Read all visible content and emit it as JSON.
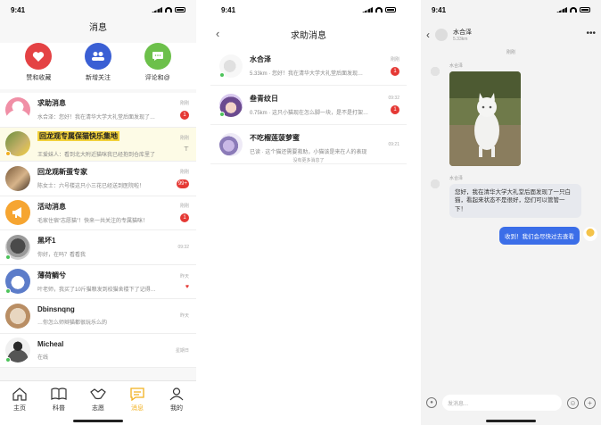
{
  "screen1": {
    "status_time": "9:41",
    "title": "消息",
    "quick_actions": [
      {
        "label": "赞和收藏",
        "icon": "heart-icon",
        "color": "#e44244"
      },
      {
        "label": "新增关注",
        "icon": "people-icon",
        "color": "#3a5fd4"
      },
      {
        "label": "评论和@",
        "icon": "comment-icon",
        "color": "#6cc04a"
      }
    ],
    "messages": [
      {
        "name": "求助消息",
        "preview": "水合泽：您好！我在清华大学大礼堂后面发现了…",
        "time": "刚刚",
        "badge": "1"
      },
      {
        "name": "回龙观专属保猫快乐集地",
        "preview": "王爱妹人：看到北大附近猫咪我已经抱到仓库里了",
        "time": "刚刚",
        "badge": ""
      },
      {
        "name": "回龙观新蛋专家",
        "preview": "陈女士：六号楼这只小三花已经送到医院啦！",
        "time": "刚刚",
        "badge": "99+"
      },
      {
        "name": "活动消息",
        "preview": "毛家住宿“志愿猫”！快来一共关注的专属猫咪！",
        "time": "刚刚",
        "badge": "1"
      },
      {
        "name": "黑坏1",
        "preview": "你好，在吗？看看我",
        "time": "09:32",
        "badge": ""
      },
      {
        "name": "薄荷鲷兮",
        "preview": "叶老师，我买了10斤猫粮发到校猫舍楼下了记得…",
        "time": "昨天",
        "badge": ""
      },
      {
        "name": "Dbinsnqng",
        "preview": "…你怎么师辫猫都很玩乐么的",
        "time": "昨天",
        "badge": ""
      },
      {
        "name": "Micheal",
        "preview": "在线",
        "time": "星期日",
        "badge": ""
      }
    ],
    "tabs": [
      {
        "label": "主页",
        "icon": "home-icon"
      },
      {
        "label": "科普",
        "icon": "book-icon"
      },
      {
        "label": "志愿",
        "icon": "handshake-icon"
      },
      {
        "label": "消息",
        "icon": "message-icon"
      },
      {
        "label": "我的",
        "icon": "person-icon"
      }
    ]
  },
  "screen2": {
    "status_time": "9:41",
    "title": "求助消息",
    "items": [
      {
        "name": "水合泽",
        "preview": "5.33km · 您好！我在清华大学大礼堂后面发现…",
        "time": "刚刚",
        "badge": "1"
      },
      {
        "name": "叁青纹日",
        "preview": "0.75km · 这只小猫现在怎么脚一块，是不是打架…",
        "time": "09:32",
        "badge": "1"
      },
      {
        "name": "不吃榴莲菠萝蜜",
        "preview": "已读 · 这个猫还需要救助，小猫该是来在人的表现",
        "time": "09:21",
        "badge": ""
      }
    ],
    "end_note": "没有更多消息了"
  },
  "screen3": {
    "status_time": "9:41",
    "contact_name": "水合泽",
    "contact_distance": "5.33km",
    "chat_time": "刚刚",
    "sender_name": "水合泽",
    "incoming_text": "您好，我在清华大学大礼堂后面发现了一只白猫，看起来状态不是很好，您们可以管管一下！",
    "outgoing_text": "收到！我们会尽快过去查看",
    "input_placeholder": "发消息..."
  },
  "colors": {
    "accent": "#f2b01e",
    "badge": "#e53935",
    "bubble_out": "#3b6ee8"
  }
}
